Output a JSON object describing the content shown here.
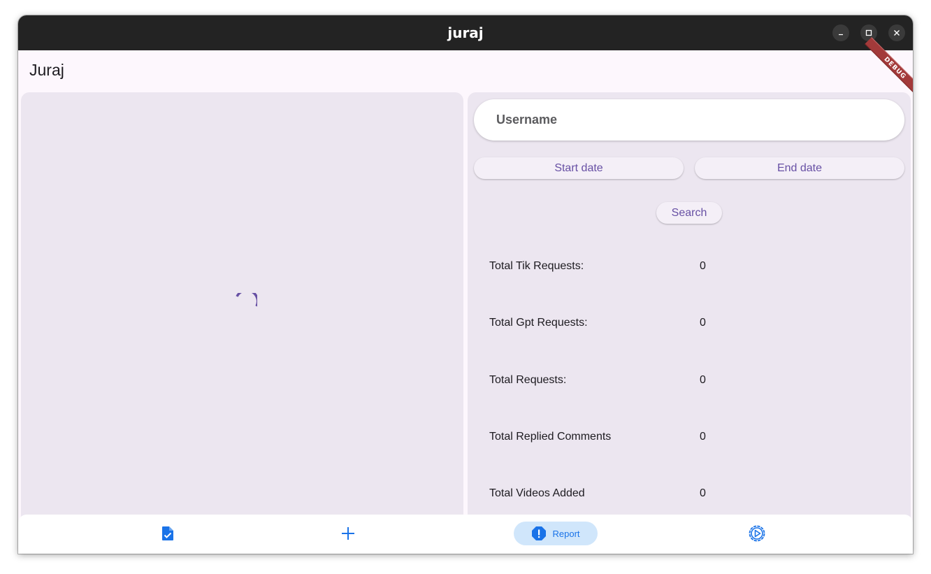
{
  "window": {
    "title": "juraj",
    "controls": {
      "minimize": "minimize-icon",
      "maximize": "maximize-icon",
      "close": "close-icon"
    }
  },
  "appbar": {
    "title": "Juraj",
    "debug_banner": "DEBUG"
  },
  "left_panel": {
    "loading_indicator": "progress-spinner-icon"
  },
  "form": {
    "username_placeholder": "Username",
    "start_date_label": "Start date",
    "end_date_label": "End date",
    "search_label": "Search"
  },
  "stats": [
    {
      "label": "Total Tik Requests:",
      "value": "0"
    },
    {
      "label": "Total Gpt Requests:",
      "value": "0"
    },
    {
      "label": "Total Requests:",
      "value": "0"
    },
    {
      "label": "Total Replied Comments",
      "value": "0"
    },
    {
      "label": "Total Videos Added",
      "value": "0"
    }
  ],
  "nav": {
    "items": [
      {
        "icon": "document-check-icon",
        "label": ""
      },
      {
        "icon": "plus-icon",
        "label": ""
      },
      {
        "icon": "report-icon",
        "label": "Report",
        "selected": true
      },
      {
        "icon": "settings-icon",
        "label": ""
      }
    ]
  },
  "colors": {
    "accent": "#6750a4",
    "nav_accent": "#1a73e8",
    "panel_bg": "#ece6f0",
    "titlebar_bg": "#232323",
    "debug_ribbon": "#a33a3a"
  }
}
